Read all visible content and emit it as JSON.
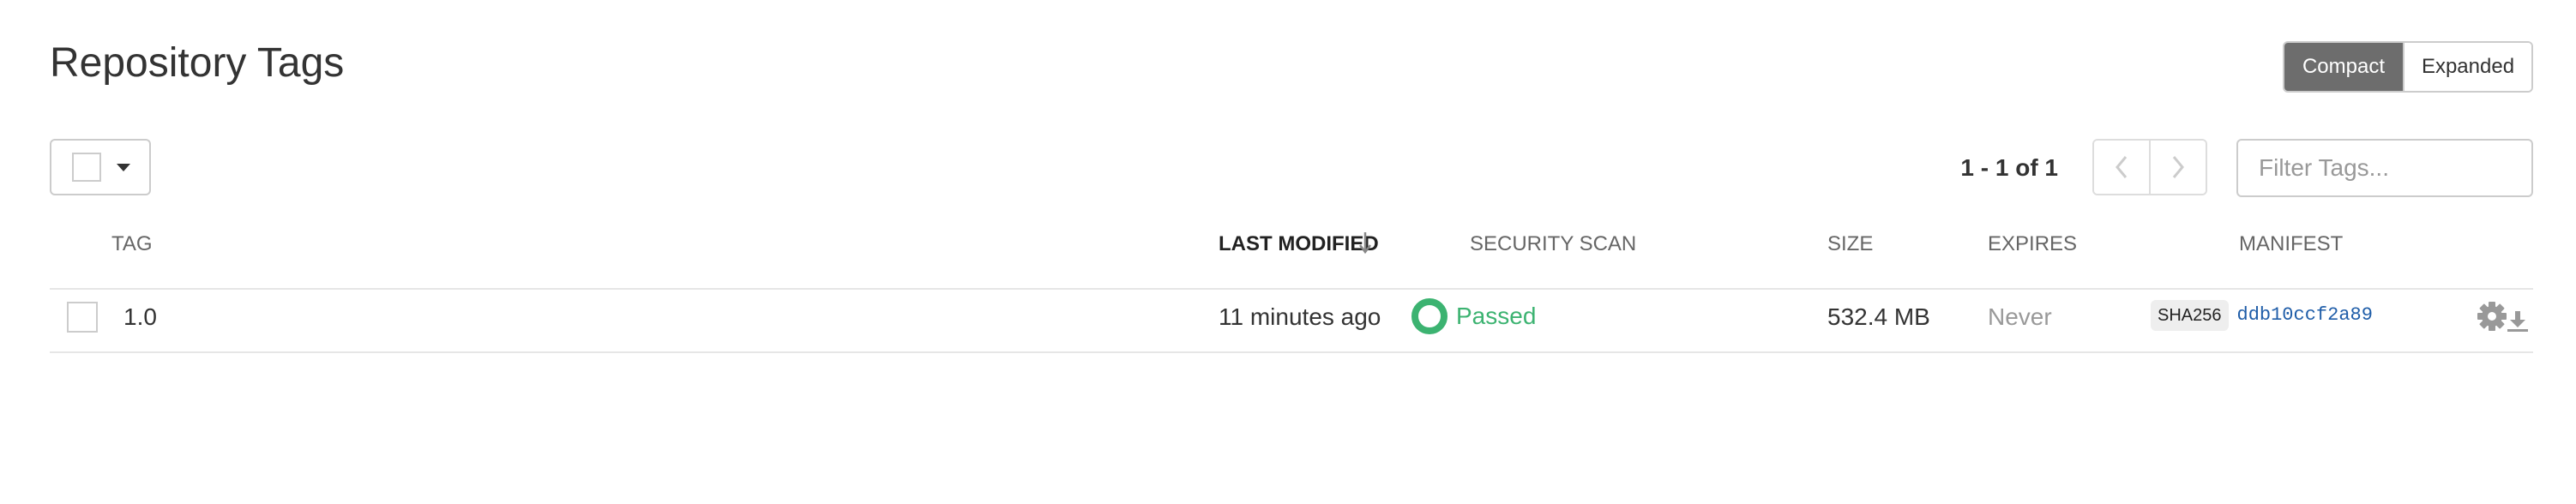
{
  "page": {
    "title": "Repository Tags"
  },
  "view_toggle": {
    "compact": "Compact",
    "expanded": "Expanded",
    "active": "compact"
  },
  "toolbar": {
    "pagination_text": "1 - 1 of 1",
    "filter_placeholder": "Filter Tags..."
  },
  "table": {
    "columns": {
      "tag": "TAG",
      "last_modified": "LAST MODIFIED",
      "security_scan": "SECURITY SCAN",
      "size": "SIZE",
      "expires": "EXPIRES",
      "manifest": "MANIFEST"
    },
    "sort": {
      "column": "last_modified",
      "direction": "descending"
    },
    "rows": [
      {
        "tag": "1.0",
        "last_modified": "11 minutes ago",
        "security_scan": "Passed",
        "size": "532.4 MB",
        "expires": "Never",
        "manifest_algo": "SHA256",
        "manifest_digest": "ddb10ccf2a89"
      }
    ]
  },
  "icons": {
    "sort": "sort-arrow-down-icon",
    "prev": "chevron-left-icon",
    "next": "chevron-right-icon",
    "scan": "security-scan-passed-icon",
    "download": "download-icon",
    "settings": "gear-icon"
  },
  "colors": {
    "passed": "#3cb371",
    "toggle_active_bg": "#6d6d6d",
    "digest": "#1f5da8"
  }
}
